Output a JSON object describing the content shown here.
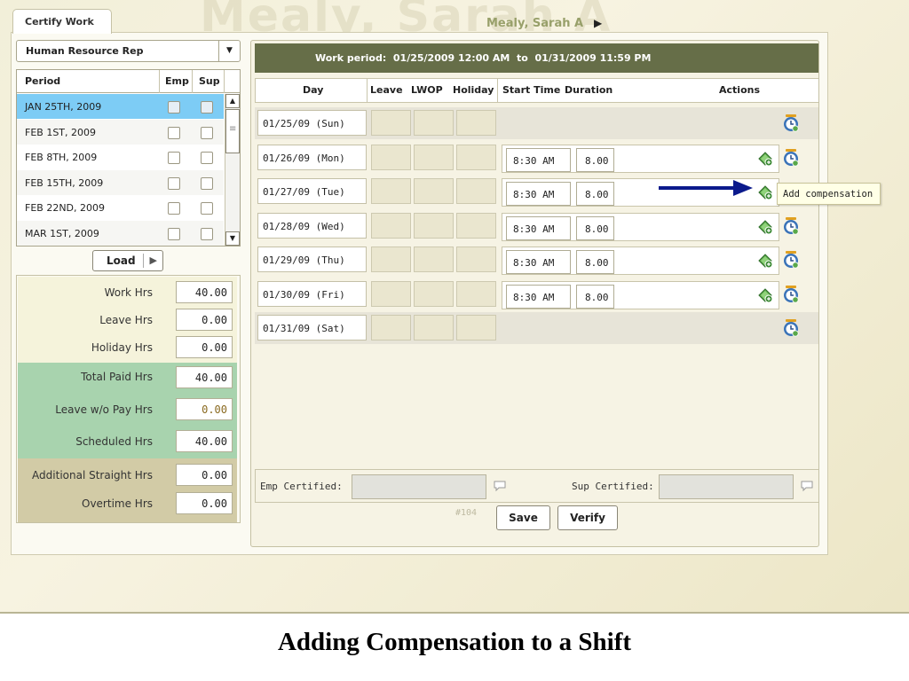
{
  "background_watermark": "Mealy, Sarah A",
  "tab": {
    "label": "Certify Work"
  },
  "user": {
    "name": "Mealy, Sarah A"
  },
  "role_select": {
    "value": "Human Resource Rep"
  },
  "period_grid": {
    "headers": {
      "period": "Period",
      "emp": "Emp",
      "sup": "Sup"
    },
    "rows": [
      {
        "label": "JAN 25TH, 2009",
        "selected": true
      },
      {
        "label": "FEB 1ST, 2009",
        "selected": false
      },
      {
        "label": "FEB 8TH, 2009",
        "selected": false
      },
      {
        "label": "FEB 15TH, 2009",
        "selected": false
      },
      {
        "label": "FEB 22ND, 2009",
        "selected": false
      },
      {
        "label": "MAR 1ST, 2009",
        "selected": false
      }
    ]
  },
  "load_button": {
    "label": "Load"
  },
  "totals": {
    "work_hrs": {
      "label": "Work Hrs",
      "value": "40.00"
    },
    "leave_hrs": {
      "label": "Leave Hrs",
      "value": "0.00"
    },
    "holiday_hrs": {
      "label": "Holiday Hrs",
      "value": "0.00"
    },
    "total_paid_hrs": {
      "label": "Total Paid Hrs",
      "value": "40.00"
    },
    "leave_wo_pay_hrs": {
      "label": "Leave w/o Pay Hrs",
      "value": "0.00"
    },
    "scheduled_hrs": {
      "label": "Scheduled Hrs",
      "value": "40.00"
    },
    "additional_straight_hrs": {
      "label": "Additional Straight Hrs",
      "value": "0.00"
    },
    "overtime_hrs": {
      "label": "Overtime Hrs",
      "value": "0.00"
    }
  },
  "work_period": {
    "label": "Work period:",
    "start": "01/25/2009 12:00 AM",
    "to": "to",
    "end": "01/31/2009 11:59 PM"
  },
  "columns": {
    "day": "Day",
    "leave": "Leave",
    "lwop": "LWOP",
    "holiday": "Holiday",
    "start_time": "Start Time",
    "duration": "Duration",
    "actions": "Actions"
  },
  "days": [
    {
      "day": "01/25/09 (Sun)",
      "type": "weekend",
      "start": "",
      "duration": ""
    },
    {
      "day": "01/26/09 (Mon)",
      "type": "weekday",
      "start": "8:30 AM",
      "duration": "8.00"
    },
    {
      "day": "01/27/09 (Tue)",
      "type": "weekday",
      "start": "8:30 AM",
      "duration": "8.00"
    },
    {
      "day": "01/28/09 (Wed)",
      "type": "weekday",
      "start": "8:30 AM",
      "duration": "8.00"
    },
    {
      "day": "01/29/09 (Thu)",
      "type": "weekday",
      "start": "8:30 AM",
      "duration": "8.00"
    },
    {
      "day": "01/30/09 (Fri)",
      "type": "weekday",
      "start": "8:30 AM",
      "duration": "8.00"
    },
    {
      "day": "01/31/09 (Sat)",
      "type": "weekend",
      "start": "",
      "duration": ""
    }
  ],
  "certification": {
    "emp_label": "Emp Certified:",
    "sup_label": "Sup Certified:"
  },
  "record_number": "#104",
  "buttons": {
    "save": "Save",
    "verify": "Verify"
  },
  "tooltip": {
    "text": "Add compensation"
  },
  "caption": "Adding Compensation to a Shift",
  "colors": {
    "header_bar": "#666e48",
    "selected_row": "#7dccf5",
    "annotation_arrow": "#0b1a8c"
  },
  "icons": {
    "add_compensation": "add-compensation-icon",
    "clock": "clock-icon",
    "comment": "comment-icon"
  }
}
